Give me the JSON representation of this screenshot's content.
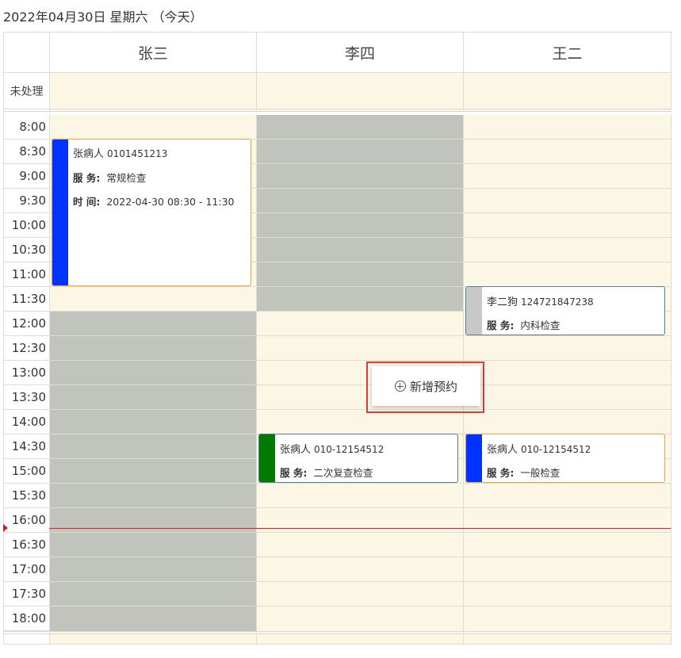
{
  "date_title": "2022年04月30日 星期六 （今天）",
  "unprocessed_label": "未处理",
  "staff": [
    "张三",
    "李四",
    "王二"
  ],
  "time_slots": [
    "8:00",
    "8:30",
    "9:00",
    "9:30",
    "10:00",
    "10:30",
    "11:00",
    "11:30",
    "12:00",
    "12:30",
    "13:00",
    "13:30",
    "14:00",
    "14:30",
    "15:00",
    "15:30",
    "16:00",
    "16:30",
    "17:00",
    "17:30",
    "18:00"
  ],
  "appointments": {
    "zhangsan_1": {
      "patient": "张病人",
      "phone": "0101451213",
      "service_label": "服 务:",
      "service": "常规检查",
      "time_label": "时 间:",
      "time": "2022-04-30 08:30 - 11:30",
      "color": "#0033ff"
    },
    "lisi_1": {
      "patient": "张病人",
      "phone": "010-12154512",
      "service_label": "服 务:",
      "service": "二次复查检查",
      "color": "#007a00"
    },
    "wanger_1": {
      "patient": "李二狗",
      "phone": "124721847238",
      "service_label": "服 务:",
      "service": "内科检查",
      "color": "#c8c8c8"
    },
    "wanger_2": {
      "patient": "张病人",
      "phone": "010-12154512",
      "service_label": "服 务:",
      "service": "一般检查",
      "color": "#0033ff"
    }
  },
  "add_appointment_label": "新增预约",
  "colors": {
    "free_slot": "#fcf6e4",
    "blocked_slot": "#c1c4bc",
    "now_line": "#d61f1f"
  }
}
